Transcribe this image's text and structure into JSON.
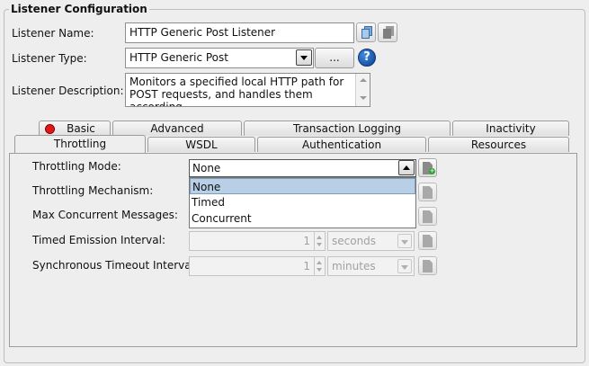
{
  "group_title": "Listener Configuration",
  "listener_name": {
    "label": "Listener Name:",
    "value": "HTTP Generic Post Listener"
  },
  "listener_type": {
    "label": "Listener Type:",
    "value": "HTTP Generic Post",
    "browse_label": "..."
  },
  "listener_description": {
    "label": "Listener Description:",
    "value": "Monitors a specified local HTTP path for POST requests, and handles them according"
  },
  "tabs_row1": [
    {
      "label": "Basic",
      "status_color": "#dd1a1a"
    },
    {
      "label": "Advanced"
    },
    {
      "label": "Transaction Logging"
    },
    {
      "label": "Inactivity"
    }
  ],
  "tabs_row2": [
    {
      "label": "Throttling",
      "selected": true
    },
    {
      "label": "WSDL"
    },
    {
      "label": "Authentication"
    },
    {
      "label": "Resources"
    }
  ],
  "throttling": {
    "mode_label": "Throttling Mode:",
    "mode_value": "None",
    "mode_options": [
      "None",
      "Timed",
      "Concurrent"
    ],
    "mechanism_label": "Throttling Mechanism:",
    "max_concurrent_label": "Max Concurrent Messages:",
    "timed_emission_label": "Timed Emission Interval:",
    "timed_emission_value": "1",
    "timed_emission_unit": "seconds",
    "sync_timeout_label": "Synchronous Timeout Interval:",
    "sync_timeout_value": "1",
    "sync_timeout_unit": "minutes"
  },
  "help_symbol": "?"
}
